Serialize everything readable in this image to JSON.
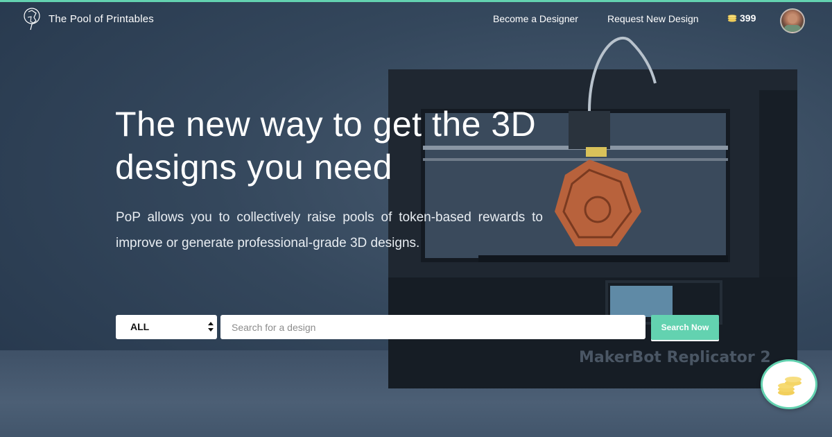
{
  "brand": {
    "name": "The Pool of Printables"
  },
  "nav": {
    "become_designer": "Become a Designer",
    "request_design": "Request New Design",
    "token_balance": "399",
    "token_icon": "coins-icon"
  },
  "hero": {
    "headline": "The new way to get the 3D designs you need",
    "subtext": "PoP allows you to collectively raise pools of token-based rewards to improve or generate professional-grade 3D designs."
  },
  "search": {
    "category_selected": "ALL",
    "placeholder": "Search for a design",
    "value": "",
    "button_label": "Search Now"
  },
  "colors": {
    "accent": "#63d2b0",
    "coin": "#f2cf5b",
    "background": "#2c3c4f"
  }
}
